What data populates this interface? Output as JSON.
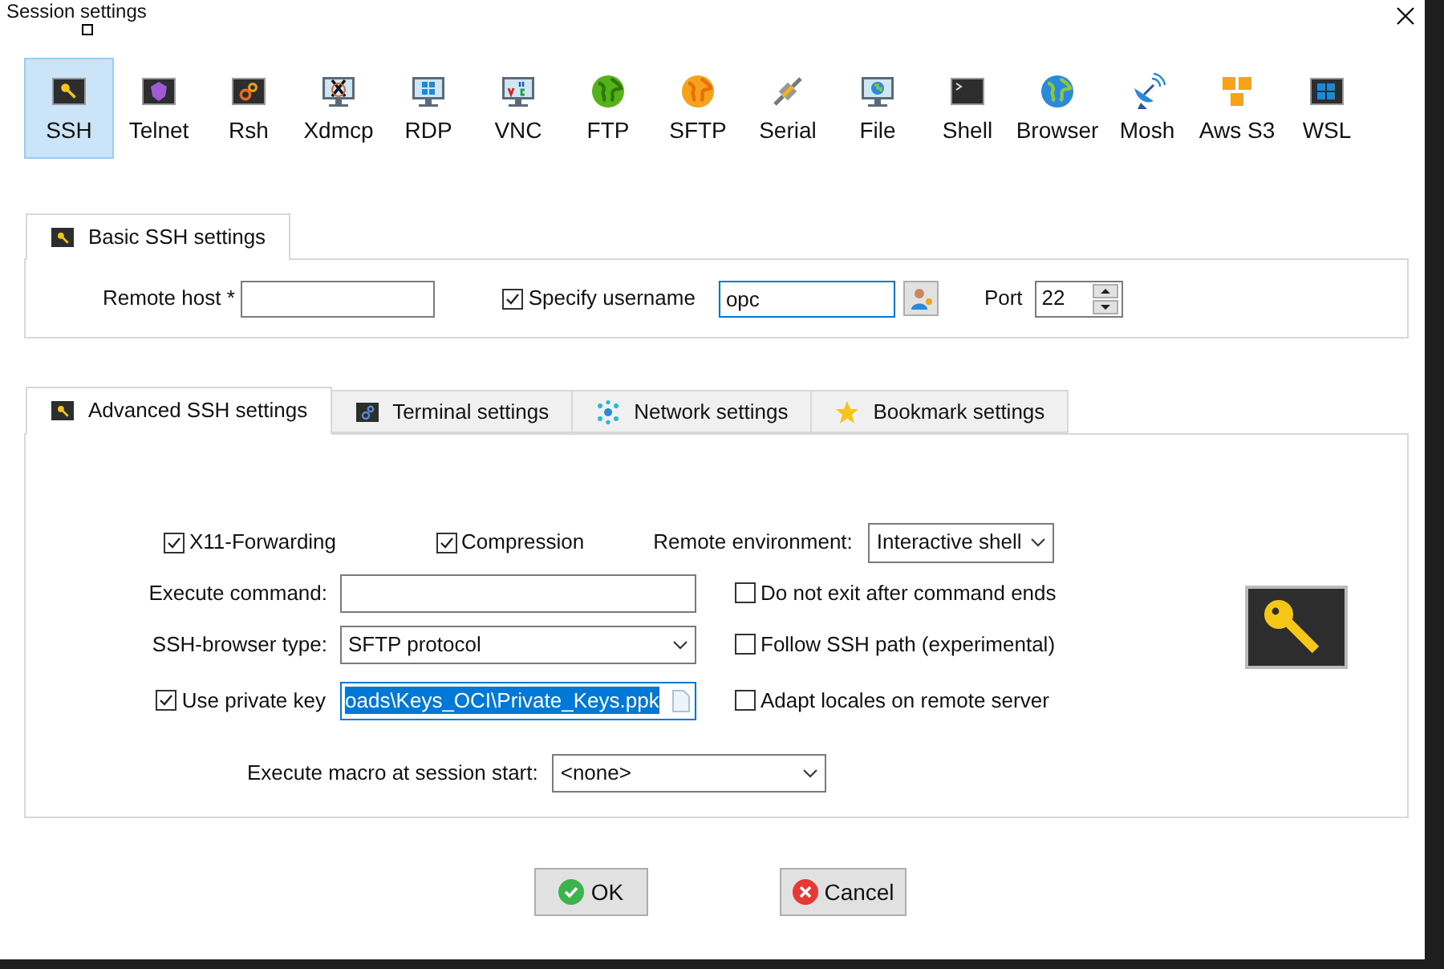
{
  "window": {
    "title": "Session settings"
  },
  "session_types": [
    {
      "label": "SSH",
      "selected": true,
      "kind": "ssh"
    },
    {
      "label": "Telnet",
      "selected": false,
      "kind": "telnet"
    },
    {
      "label": "Rsh",
      "selected": false,
      "kind": "rsh"
    },
    {
      "label": "Xdmcp",
      "selected": false,
      "kind": "xdmcp"
    },
    {
      "label": "RDP",
      "selected": false,
      "kind": "rdp"
    },
    {
      "label": "VNC",
      "selected": false,
      "kind": "vnc"
    },
    {
      "label": "FTP",
      "selected": false,
      "kind": "ftp"
    },
    {
      "label": "SFTP",
      "selected": false,
      "kind": "sftp"
    },
    {
      "label": "Serial",
      "selected": false,
      "kind": "serial"
    },
    {
      "label": "File",
      "selected": false,
      "kind": "file"
    },
    {
      "label": "Shell",
      "selected": false,
      "kind": "shell"
    },
    {
      "label": "Browser",
      "selected": false,
      "kind": "browser"
    },
    {
      "label": "Mosh",
      "selected": false,
      "kind": "mosh"
    },
    {
      "label": "Aws S3",
      "selected": false,
      "kind": "s3"
    },
    {
      "label": "WSL",
      "selected": false,
      "kind": "wsl"
    }
  ],
  "basic_tab": {
    "label": "Basic SSH settings"
  },
  "basic": {
    "remote_host": {
      "label": "Remote host *"
    },
    "specify_username": {
      "label": "Specify username",
      "checked": true
    },
    "username": {
      "value": "opc"
    },
    "port": {
      "label": "Port",
      "value": "22"
    }
  },
  "tabs": [
    {
      "label": "Advanced SSH settings",
      "selected": true,
      "kind": "key"
    },
    {
      "label": "Terminal settings",
      "selected": false,
      "kind": "terminal"
    },
    {
      "label": "Network settings",
      "selected": false,
      "kind": "network"
    },
    {
      "label": "Bookmark settings",
      "selected": false,
      "kind": "star"
    }
  ],
  "advanced": {
    "x11_forwarding": {
      "label": "X11-Forwarding",
      "checked": true
    },
    "compression": {
      "label": "Compression",
      "checked": true
    },
    "remote_environment": {
      "label": "Remote environment:",
      "value": "Interactive shell"
    },
    "execute_command": {
      "label": "Execute command:"
    },
    "do_not_exit": {
      "label": "Do not exit after command ends",
      "checked": false
    },
    "browser_type": {
      "label": "SSH-browser type:",
      "value": "SFTP protocol"
    },
    "follow_ssh_path": {
      "label": "Follow SSH path (experimental)",
      "checked": false
    },
    "use_private_key": {
      "label": "Use private key",
      "checked": true,
      "value": "oads\\Keys_OCI\\Private_Keys.ppk"
    },
    "adapt_locales": {
      "label": "Adapt locales on remote server",
      "checked": false
    },
    "macro": {
      "label": "Execute macro at session start:",
      "value": "<none>"
    }
  },
  "buttons": [
    {
      "label": "OK",
      "kind": "ok"
    },
    {
      "label": "Cancel",
      "kind": "cancel"
    }
  ]
}
